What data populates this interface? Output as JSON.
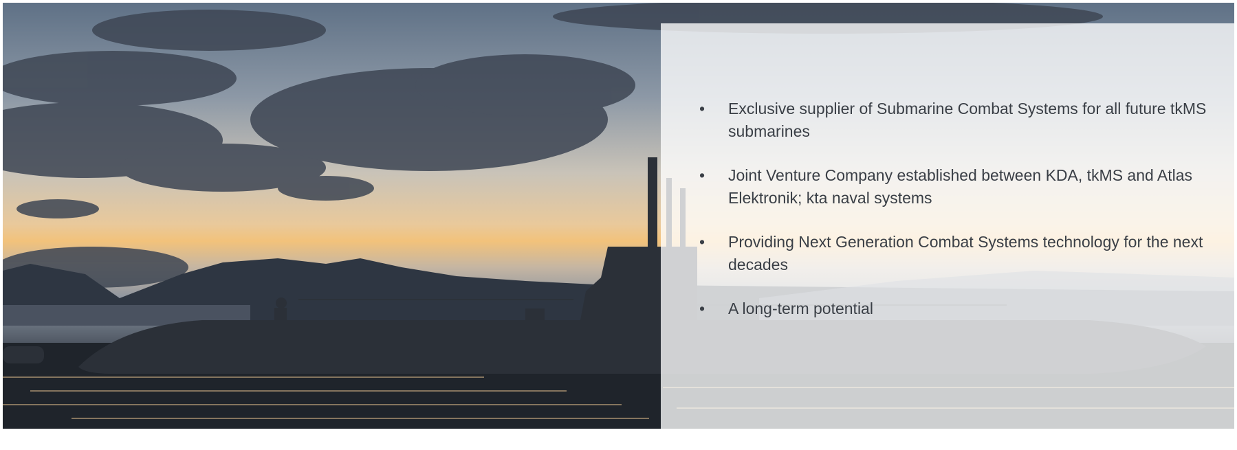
{
  "slide": {
    "bullet_glyph": "•",
    "bullets": [
      "Exclusive supplier of Submarine Combat Systems for all future tkMS submarines",
      "Joint Venture Company established between KDA, tkMS and Atlas Elektronik; kta naval systems",
      "Providing Next Generation Combat Systems technology for the next decades",
      "A long-term potential"
    ]
  },
  "colors": {
    "overlay": "#ffffff",
    "text": "#3a3f46",
    "sky_top": "#5f7186",
    "sunset": "#f2c27b",
    "hull": "#2b3038"
  }
}
